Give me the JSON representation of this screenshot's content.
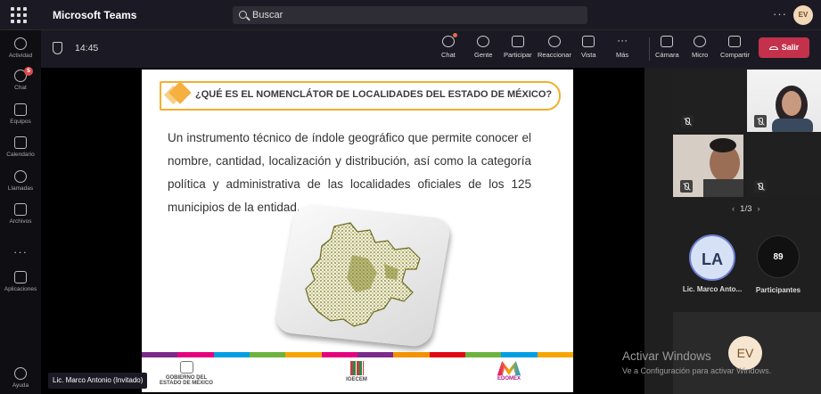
{
  "app": {
    "title": "Microsoft Teams",
    "avatar_initials": "EV"
  },
  "search": {
    "placeholder": "Buscar"
  },
  "rail": [
    {
      "label": "Actividad",
      "icon": "bell-icon"
    },
    {
      "label": "Chat",
      "icon": "chat-icon",
      "badge": "5"
    },
    {
      "label": "Equipos",
      "icon": "teams-icon"
    },
    {
      "label": "Calendario",
      "icon": "calendar-icon"
    },
    {
      "label": "Llamadas",
      "icon": "phone-icon"
    },
    {
      "label": "Archivos",
      "icon": "file-icon"
    },
    {
      "label": "Aplicaciones",
      "icon": "apps-icon"
    },
    {
      "label": "Ayuda",
      "icon": "help-icon"
    }
  ],
  "meeting": {
    "timer": "14:45",
    "controls": [
      "Chat",
      "Gente",
      "Participar",
      "Reaccionar",
      "Vista",
      "Más",
      "Cámara",
      "Micro",
      "Compartir"
    ],
    "leave_label": "Salir"
  },
  "slide": {
    "title": "¿QUÉ ES EL NOMENCLÁTOR DE LOCALIDADES DEL ESTADO DE MÉXICO?",
    "body": "Un instrumento técnico de índole geográfico que permite conocer el nombre, cantidad, localización y distribución, así como la categoría política y administrativa de las localidades oficiales de los 125 municipios de la entidad.",
    "logos": [
      "GOBIERNO DEL ESTADO DE MÉXICO",
      "IGECEM",
      "EDOMÉX"
    ],
    "strip_colors": [
      "#7a2a8a",
      "#e6007e",
      "#009fe3",
      "#6cb33f",
      "#f7a600",
      "#e6007e",
      "#7a2a8a",
      "#f39200",
      "#e30613",
      "#6cb33f",
      "#009fe3",
      "#f7a600"
    ]
  },
  "presenter": {
    "name": "Lic. Marco Antonio (Invitado)"
  },
  "gallery": {
    "pager": "1/3",
    "participant_initials": "LA",
    "participant_name": "Lic. Marco Anto...",
    "participants_count": "89",
    "participants_label": "Participantes"
  },
  "self_view": {
    "initials": "EV"
  },
  "watermark": {
    "line1": "Activar Windows",
    "line2": "Ve a Configuración para activar Windows."
  }
}
